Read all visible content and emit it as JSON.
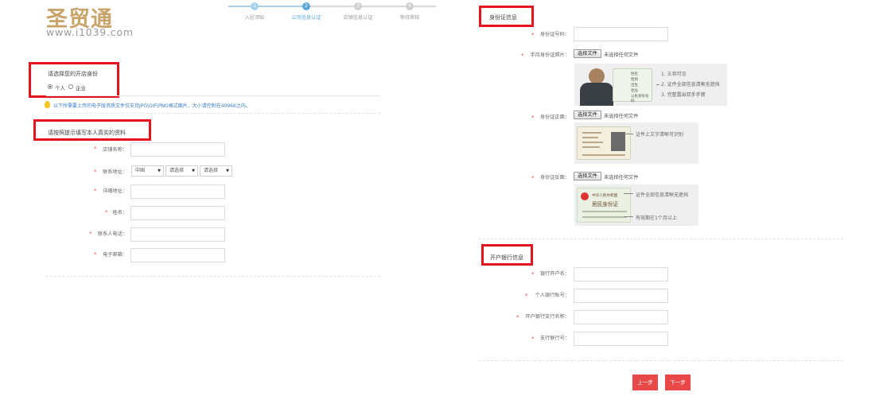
{
  "logo": {
    "cn": "圣贸通",
    "url": "www.i1039.com"
  },
  "steps": [
    {
      "num": "1",
      "label": "入驻须知",
      "state": "done"
    },
    {
      "num": "2",
      "label": "公司信息认证",
      "state": "active"
    },
    {
      "num": "3",
      "label": "店铺信息认证",
      "state": "todo"
    },
    {
      "num": "4",
      "label": "等待审核",
      "state": "todo"
    }
  ],
  "identity": {
    "title": "请选择您的开店身份",
    "options": [
      {
        "label": "个人",
        "checked": true
      },
      {
        "label": "企业",
        "checked": false
      }
    ]
  },
  "tip": "以下所需要上传的电子版资质文件仅支持JPG\\GIF\\PNG格式图片，大小请控制在4096K之内。",
  "basic": {
    "title": "请按照提示填写本人真实的资料",
    "fields": {
      "store_name": "店铺名称：",
      "address": "联系地址：",
      "detail_address": "详细地址：",
      "name": "姓名：",
      "phone": "联系人电话：",
      "email": "电子邮箱："
    },
    "selects": {
      "country": "中国",
      "province": "请选择",
      "city": "请选择"
    }
  },
  "id_card": {
    "title": "身份证信息",
    "fields": {
      "id_number": "身份证号码：",
      "hand_photo": "手持身份证照片：",
      "front": "身份证正面：",
      "back": "身份证反面："
    },
    "file_button": "选择文件",
    "file_none": "未选择任何文件",
    "hand_notes": [
      "1. 五官可见",
      "2. 证件全部信息清晰无遮挡",
      "3. 完整露出双手手臂"
    ],
    "hand_card_lines": [
      "姓名",
      "性别",
      "出生",
      "住址",
      "公民身份号码"
    ],
    "front_note": "证件上文字清晰可识别",
    "back_notes": [
      "证件全部信息清晰无遮挡",
      "有效期在1个月以上"
    ],
    "back_card_title": "中华人民共和国",
    "back_card_main": "居民身份证"
  },
  "bank": {
    "title": "开户银行信息",
    "fields": {
      "account_name": "银行开户名：",
      "account_no": "个人银行账号：",
      "branch_name": "开户银行支行名称：",
      "branch_code": "支行联行号："
    }
  },
  "buttons": {
    "prev": "上一步",
    "next": "下一步"
  },
  "colors": {
    "brand_gold": "#c8a46a",
    "step_active": "#5aa7d8",
    "step_inactive": "#cccccc",
    "annotation_red": "#e3141e",
    "button_red": "#e94848",
    "required_star": "#e84b4b",
    "tip_blue": "#3b7cc4"
  }
}
